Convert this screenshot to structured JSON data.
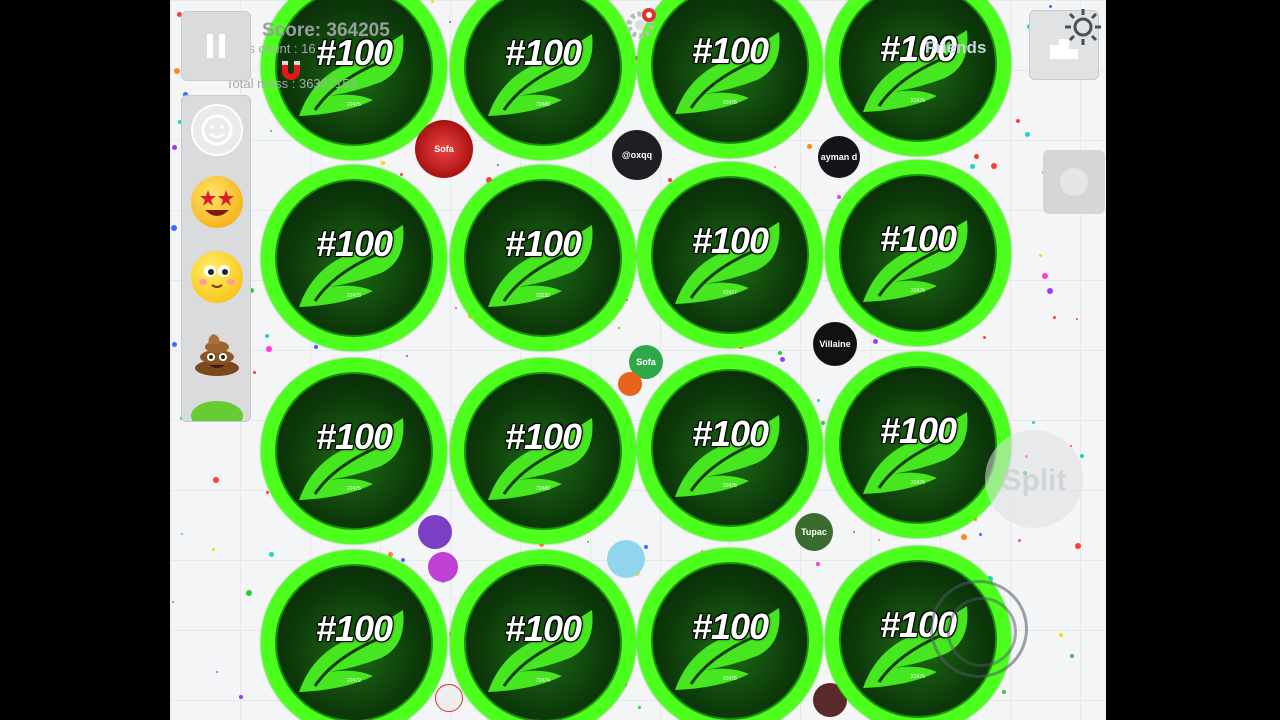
{
  "hud": {
    "score": "Score: 364205",
    "cells_count": "Cells count : 16",
    "total_mass": "Total mass : 36367153",
    "friends": "Friends",
    "split_hint": "Split"
  },
  "player": {
    "nickname": "#100",
    "cell_masses": [
      "22475",
      "22480",
      "22475",
      "22475",
      "22473",
      "22532",
      "22477",
      "22475",
      "22475",
      "22480",
      "22476",
      "22475",
      "22472",
      "22474",
      "22476",
      "22475"
    ]
  },
  "other_players": [
    {
      "name": "Sofa",
      "color": "#c0241a"
    },
    {
      "name": "@oxqq",
      "color": "#1d1f22"
    },
    {
      "name": "ayman d",
      "color": "#141518"
    },
    {
      "name": "Sofa",
      "color": "#2fa84a"
    },
    {
      "name": "Villaine",
      "color": "#111"
    },
    {
      "name": "Tupac",
      "color": "#3c6b2f"
    }
  ],
  "colors": {
    "cell_ring": "#4cff1d",
    "cell_core": "#0d3a0a",
    "background": "#f4f5f6"
  },
  "icons": [
    "pause-icon",
    "magnet-icon",
    "gear-icon",
    "leaderboard-icon",
    "face-icon",
    "star-eyes-emoji",
    "blush-emoji",
    "poop-emoji"
  ]
}
